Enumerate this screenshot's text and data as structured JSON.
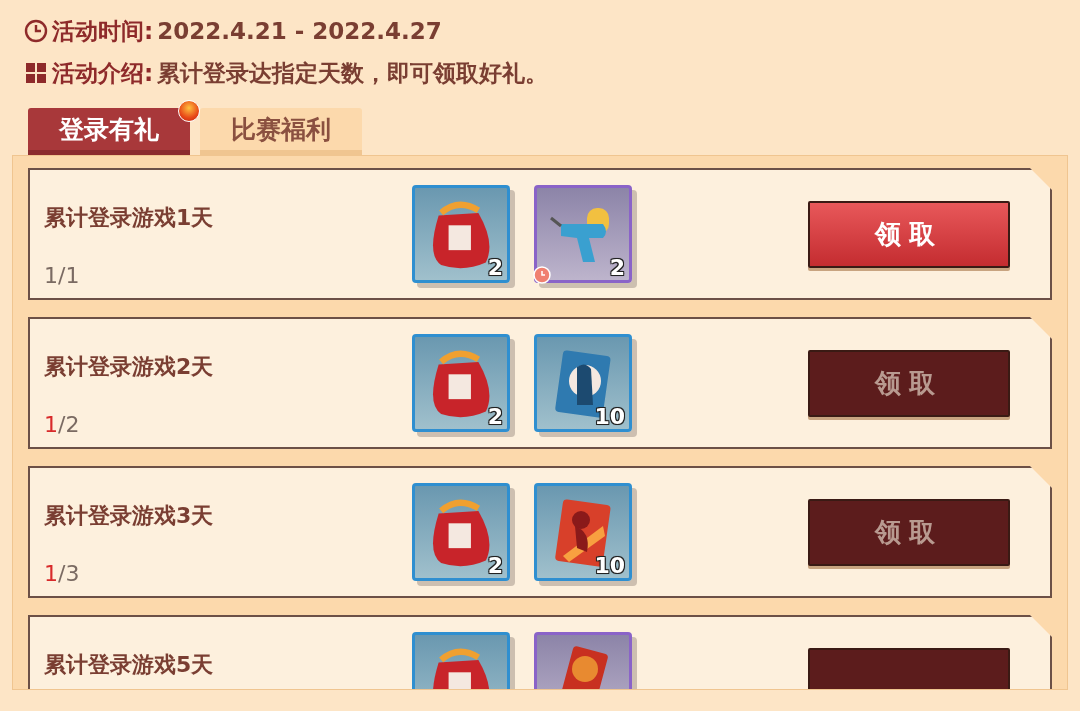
{
  "info": [
    {
      "kind": "clock",
      "label": "活动时间:",
      "text": "2022.4.21 - 2022.4.27"
    },
    {
      "kind": "grid",
      "label": "活动介绍:",
      "text": "累计登录达指定天数，即可领取好礼。"
    }
  ],
  "tabs": [
    {
      "label": "登录有礼",
      "selected": true,
      "badge": true
    },
    {
      "label": "比赛福利",
      "selected": false,
      "badge": false
    }
  ],
  "tasks": [
    {
      "title": "累计登录游戏1天",
      "progress_current": "1",
      "progress_total": "/1",
      "complete": true,
      "claimable": true,
      "button": "领取",
      "rewards": [
        {
          "kind": "bag",
          "color": "#2f8fd0",
          "count": "2",
          "timed": false
        },
        {
          "kind": "gun",
          "color": "#8a63c8",
          "count": "2",
          "timed": true
        }
      ]
    },
    {
      "title": "累计登录游戏2天",
      "progress_current": "1",
      "progress_total": "/2",
      "complete": false,
      "claimable": false,
      "button": "领取",
      "rewards": [
        {
          "kind": "bag",
          "color": "#2f8fd0",
          "count": "2",
          "timed": false
        },
        {
          "kind": "card-blue",
          "color": "#2f8fd0",
          "count": "10",
          "timed": false
        }
      ]
    },
    {
      "title": "累计登录游戏3天",
      "progress_current": "1",
      "progress_total": "/3",
      "complete": false,
      "claimable": false,
      "button": "领取",
      "rewards": [
        {
          "kind": "bag",
          "color": "#2f8fd0",
          "count": "2",
          "timed": false
        },
        {
          "kind": "card-red",
          "color": "#2f8fd0",
          "count": "10",
          "timed": false
        }
      ]
    },
    {
      "title": "累计登录游戏5天",
      "claimable": false,
      "rewards": [
        {
          "kind": "bag",
          "color": "#2f8fd0"
        },
        {
          "kind": "card-dunk",
          "color": "#8a63c8"
        }
      ]
    }
  ]
}
